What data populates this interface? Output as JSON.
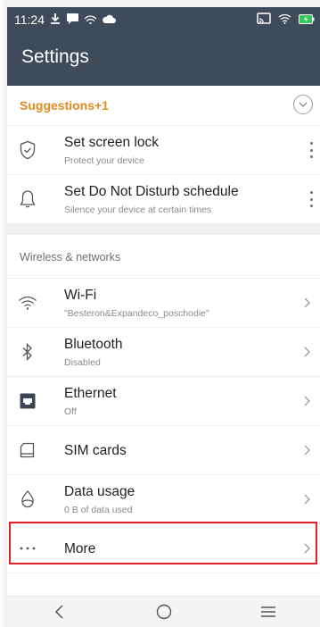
{
  "status_bar": {
    "time": "11:24"
  },
  "app_bar": {
    "title": "Settings"
  },
  "suggestions": {
    "title": "Suggestions+1",
    "items": [
      {
        "title": "Set screen lock",
        "subtitle": "Protect your device",
        "icon": "shield-check-icon"
      },
      {
        "title": "Set Do Not Disturb schedule",
        "subtitle": "Silence your device at certain times",
        "icon": "bell-icon"
      }
    ]
  },
  "wireless": {
    "title": "Wireless & networks",
    "items": [
      {
        "title": "Wi-Fi",
        "subtitle": "\"Besteron&Expandeco_poschodie\"",
        "icon": "wifi-icon"
      },
      {
        "title": "Bluetooth",
        "subtitle": "Disabled",
        "icon": "bluetooth-icon"
      },
      {
        "title": "Ethernet",
        "subtitle": "Off",
        "icon": "ethernet-icon"
      },
      {
        "title": "SIM cards",
        "icon": "sim-card-icon"
      },
      {
        "title": "Data usage",
        "subtitle": "0 B of data used",
        "icon": "data-usage-icon"
      },
      {
        "title": "More",
        "icon": "more-dots-icon"
      }
    ]
  },
  "colors": {
    "app_bar": "#3f4a5b",
    "accent": "#e58a1f",
    "highlight": "#e0242c"
  }
}
